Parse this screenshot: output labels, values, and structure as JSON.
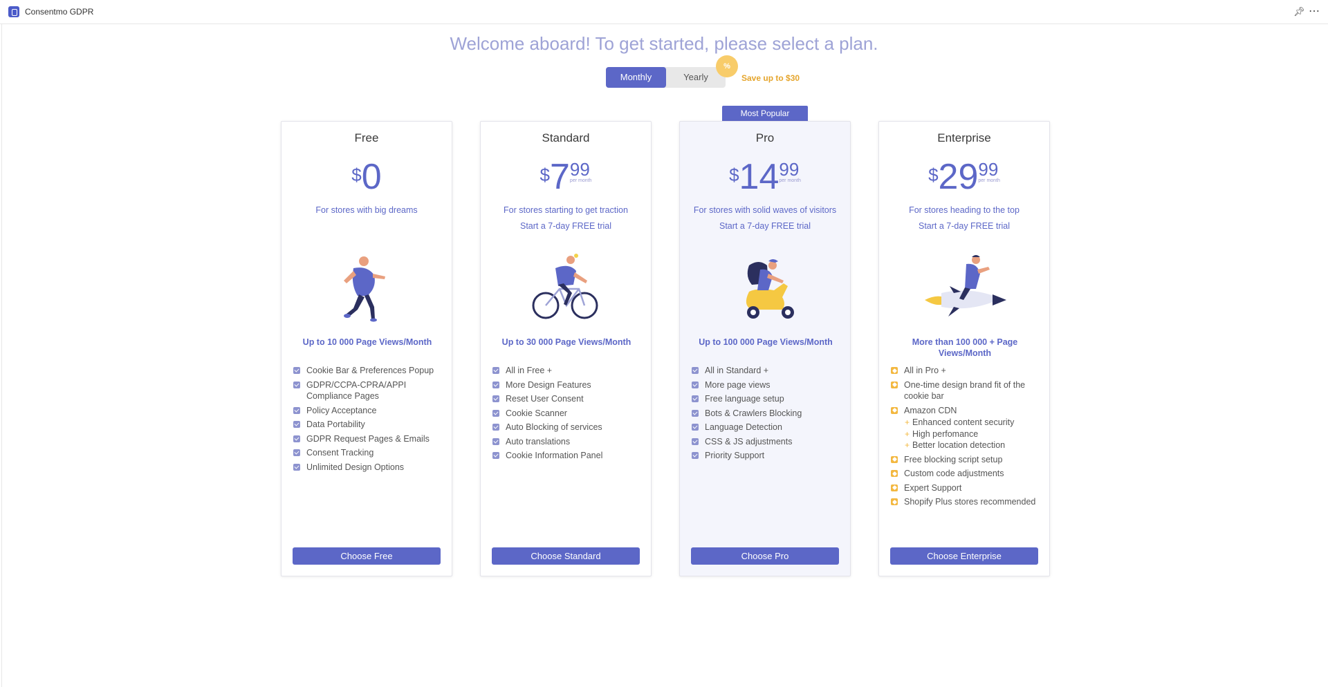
{
  "app": {
    "title": "Consentmo GDPR"
  },
  "header": {
    "welcome": "Welcome aboard! To get started, please select a plan.",
    "toggle_monthly": "Monthly",
    "toggle_yearly": "Yearly",
    "percent_badge": "%",
    "save_text": "Save up to $30",
    "most_popular": "Most Popular"
  },
  "plans": [
    {
      "name": "Free",
      "currency": "$",
      "price_main": "0",
      "price_cents": "",
      "per_month": "",
      "tagline": "For stores with big dreams",
      "trial": "",
      "views": "Up to 10 000 Page Views/Month",
      "illustration": "runner-illustration",
      "features": [
        "Cookie Bar & Preferences Popup",
        "GDPR/CCPA-CPRA/APPI Compliance Pages",
        "Policy Acceptance",
        "Data Portability",
        "GDPR Request Pages & Emails",
        "Consent Tracking",
        "Unlimited Design Options"
      ],
      "button": "Choose Free"
    },
    {
      "name": "Standard",
      "currency": "$",
      "price_main": "7",
      "price_cents": "99",
      "per_month": "per month",
      "tagline": "For stores starting to get traction",
      "trial": "Start a 7-day FREE trial",
      "views": "Up to 30 000 Page Views/Month",
      "illustration": "cyclist-illustration",
      "features": [
        "All in Free +",
        "More Design Features",
        "Reset User Consent",
        "Cookie Scanner",
        "Auto Blocking of services",
        "Auto translations",
        "Cookie Information Panel"
      ],
      "button": "Choose Standard"
    },
    {
      "name": "Pro",
      "currency": "$",
      "price_main": "14",
      "price_cents": "99",
      "per_month": "per month",
      "tagline": "For stores with solid waves of visitors",
      "trial": "Start a 7-day FREE trial",
      "views": "Up to 100 000 Page Views/Month",
      "illustration": "scooter-illustration",
      "features": [
        "All in Standard +",
        "More page views",
        "Free language setup",
        "Bots & Crawlers Blocking",
        "Language Detection",
        "CSS & JS adjustments",
        "Priority Support"
      ],
      "button": "Choose Pro"
    },
    {
      "name": "Enterprise",
      "currency": "$",
      "price_main": "29",
      "price_cents": "99",
      "per_month": "per month",
      "tagline": "For stores heading to the top",
      "trial": "Start a 7-day FREE trial",
      "views": "More than 100 000 + Page Views/Month",
      "illustration": "rocket-illustration",
      "features": [
        "All in Pro +",
        "One-time design brand fit of the cookie bar",
        "Amazon CDN",
        "Free blocking script setup",
        "Custom code adjustments",
        "Expert Support",
        "Shopify Plus stores recommended"
      ],
      "sub_features": [
        "Enhanced content security",
        "High perfomance",
        "Better location detection"
      ],
      "button": "Choose Enterprise"
    }
  ],
  "colors": {
    "accent": "#5c67c7",
    "welcome": "#9ea3d6",
    "save": "#e5a52c",
    "badge": "#f8cc6a",
    "pro_bg": "#f4f5fc"
  }
}
